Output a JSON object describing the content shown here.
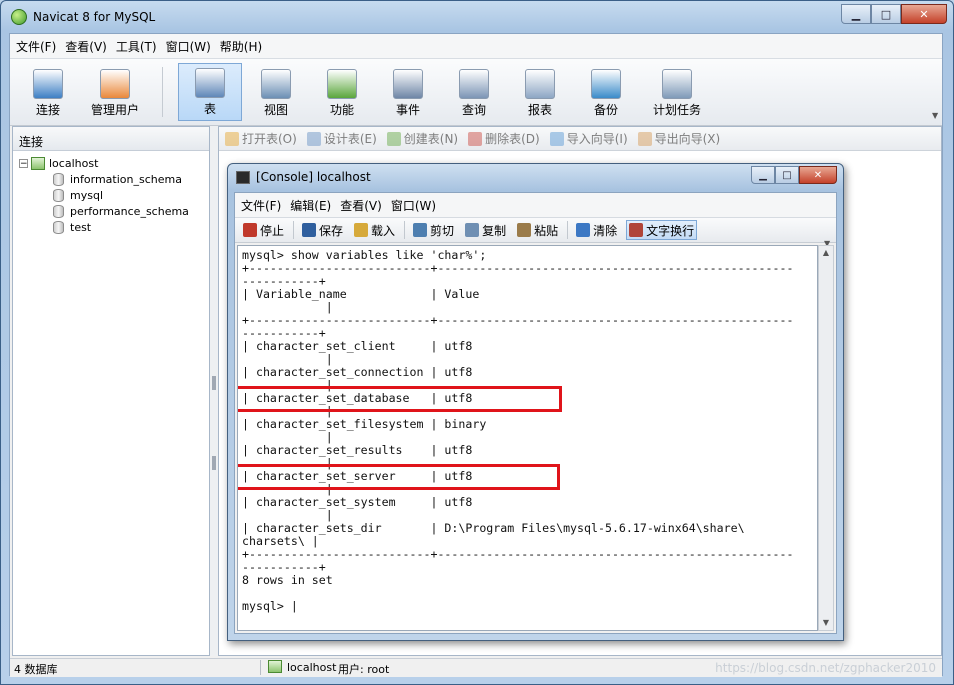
{
  "window": {
    "title": "Navicat 8 for MySQL",
    "btn_min": "▁",
    "btn_max": "□",
    "btn_close": "✕"
  },
  "menu": [
    "文件(F)",
    "查看(V)",
    "工具(T)",
    "窗口(W)",
    "帮助(H)"
  ],
  "toolbar": [
    {
      "label": "连接",
      "icon": "connect-icon",
      "color": "#3d7fc4"
    },
    {
      "label": "管理用户",
      "icon": "user-icon",
      "color": "#e9883a"
    },
    {
      "label": "表",
      "icon": "table-icon",
      "color": "#5f87b8",
      "active": true
    },
    {
      "label": "视图",
      "icon": "view-icon",
      "color": "#6c8fb4"
    },
    {
      "label": "功能",
      "icon": "function-icon",
      "color": "#5aa63c"
    },
    {
      "label": "事件",
      "icon": "event-icon",
      "color": "#6e86a6"
    },
    {
      "label": "查询",
      "icon": "query-icon",
      "color": "#7c95b5"
    },
    {
      "label": "报表",
      "icon": "report-icon",
      "color": "#8da6c4"
    },
    {
      "label": "备份",
      "icon": "backup-icon",
      "color": "#3a8bc9"
    },
    {
      "label": "计划任务",
      "icon": "schedule-icon",
      "color": "#7f9ab8"
    }
  ],
  "left_pane": {
    "header": "连接",
    "server": "localhost",
    "databases": [
      "information_schema",
      "mysql",
      "performance_schema",
      "test"
    ]
  },
  "object_toolbar": [
    "打开表(O)",
    "设计表(E)",
    "创建表(N)",
    "删除表(D)",
    "导入向导(I)",
    "导出向导(X)"
  ],
  "console": {
    "title": "[Console] localhost",
    "menu": [
      "文件(F)",
      "编辑(E)",
      "查看(V)",
      "窗口(W)"
    ],
    "toolbar": [
      {
        "label": "停止",
        "icon": "stop-icon",
        "color": "#c0392b"
      },
      {
        "label": "保存",
        "icon": "save-icon",
        "color": "#2f5f9e"
      },
      {
        "label": "载入",
        "icon": "load-icon",
        "color": "#d6a93a"
      },
      {
        "label": "剪切",
        "icon": "cut-icon",
        "color": "#4e7fb0"
      },
      {
        "label": "复制",
        "icon": "copy-icon",
        "color": "#6f8fb3"
      },
      {
        "label": "粘贴",
        "icon": "paste-icon",
        "color": "#9a7b4a"
      },
      {
        "label": "清除",
        "icon": "clear-icon",
        "color": "#3c78c4"
      },
      {
        "label": "文字换行",
        "icon": "wrap-icon",
        "color": "#b0453a",
        "active": true
      }
    ],
    "lines": [
      "mysql> show variables like 'char%';",
      "+--------------------------+---------------------------------------------------",
      "-----------+",
      "| Variable_name            | Value",
      "            |",
      "+--------------------------+---------------------------------------------------",
      "-----------+",
      "| character_set_client     | utf8",
      "            |",
      "| character_set_connection | utf8",
      "            |",
      "| character_set_database   | utf8",
      "            |",
      "| character_set_filesystem | binary",
      "            |",
      "| character_set_results    | utf8",
      "            |",
      "| character_set_server     | utf8",
      "            |",
      "| character_set_system     | utf8",
      "            |",
      "| character_sets_dir       | D:\\Program Files\\mysql-5.6.17-winx64\\share\\",
      "charsets\\ |",
      "+--------------------------+---------------------------------------------------",
      "-----------+",
      "8 rows in set",
      "",
      "mysql> |"
    ]
  },
  "status": {
    "db_count": "4 数据库",
    "server": "localhost",
    "user": "用户: root",
    "watermark": "https://blog.csdn.net/zgphacker2010"
  },
  "colors": {
    "highlight": "#e0141a",
    "accent": "#7ea8d6"
  }
}
